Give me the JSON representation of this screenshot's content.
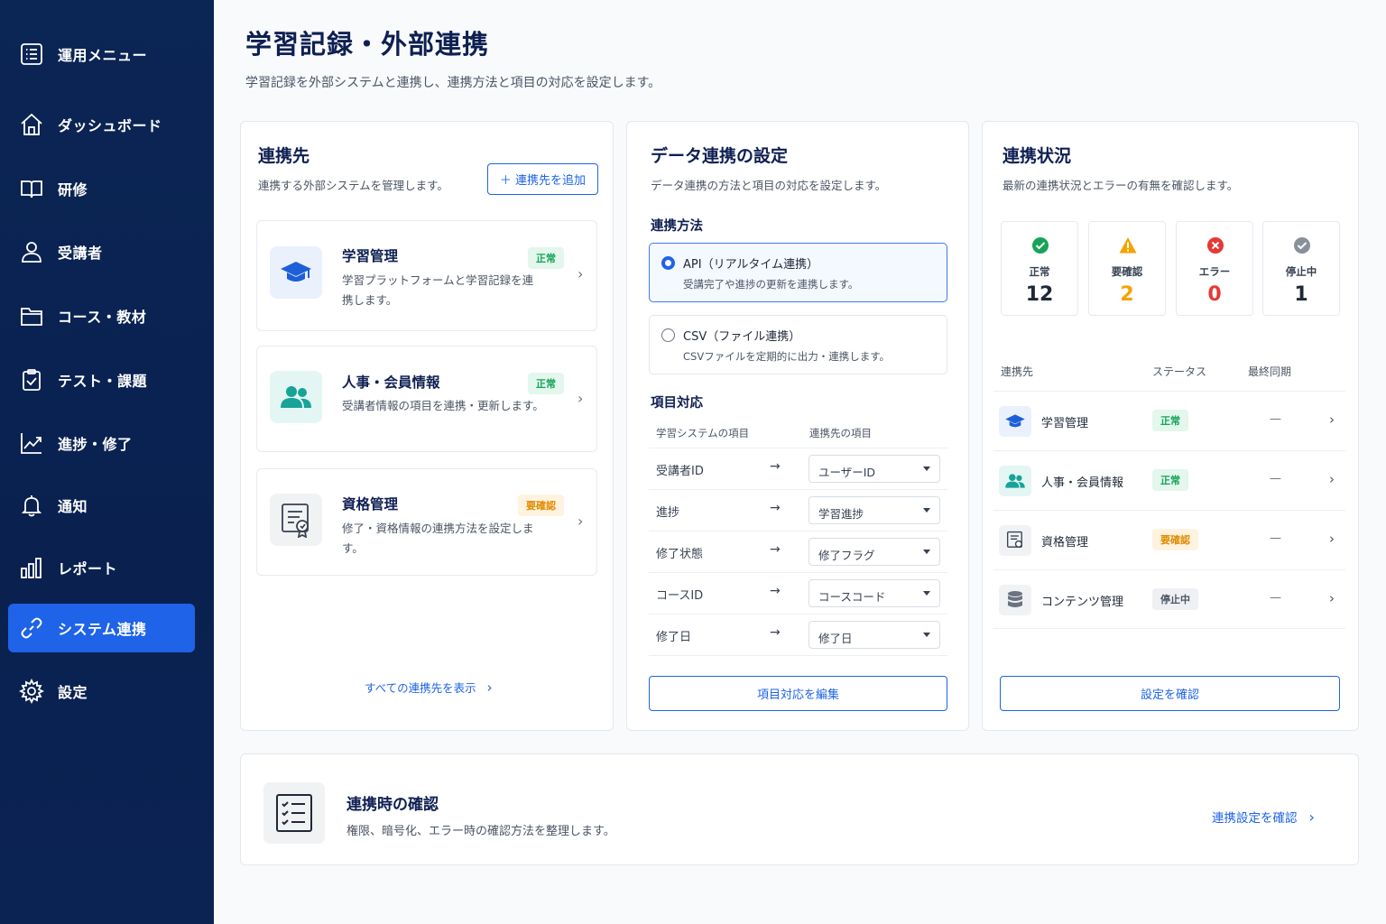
{
  "sidebar": {
    "items": [
      {
        "label": "運用メニュー",
        "icon": "menu-list-icon"
      },
      {
        "label": "ダッシュボード",
        "icon": "home-icon"
      },
      {
        "label": "研修",
        "icon": "book-icon"
      },
      {
        "label": "受講者",
        "icon": "user-icon"
      },
      {
        "label": "コース・教材",
        "icon": "folder-icon"
      },
      {
        "label": "テスト・課題",
        "icon": "clipboard-check-icon"
      },
      {
        "label": "進捗・修了",
        "icon": "line-chart-icon"
      },
      {
        "label": "通知",
        "icon": "bell-icon"
      },
      {
        "label": "レポート",
        "icon": "bar-chart-icon"
      },
      {
        "label": "システム連携",
        "icon": "link-icon",
        "active": true
      },
      {
        "label": "設定",
        "icon": "gear-icon"
      }
    ]
  },
  "page": {
    "title": "学習記録・外部連携",
    "subtitle": "学習記録を外部システムと連携し、連携方法と項目の対応を設定します。"
  },
  "destinations": {
    "title": "連携先",
    "desc": "連携する外部システムを管理します。",
    "add_button": "＋ 連携先を追加",
    "items": [
      {
        "name": "学習管理",
        "desc": "学習プラットフォームと学習記録を連携します。",
        "status": "正常",
        "icon": "graduation-cap-icon"
      },
      {
        "name": "人事・会員情報",
        "desc": "受講者情報の項目を連携・更新します。",
        "status": "正常",
        "icon": "users-icon"
      },
      {
        "name": "資格管理",
        "desc": "修了・資格情報の連携方法を設定します。",
        "status": "要確認",
        "icon": "certificate-icon"
      }
    ],
    "view_all": "すべての連携先を表示"
  },
  "data_settings": {
    "title": "データ連携の設定",
    "desc": "データ連携の方法と項目の対応を設定します。",
    "method_label": "連携方法",
    "methods": [
      {
        "title": "API（リアルタイム連携）",
        "desc": "受講完了や進捗の更新を連携します。",
        "selected": true
      },
      {
        "title": "CSV（ファイル連携）",
        "desc": "CSVファイルを定期的に出力・連携します。",
        "selected": false
      }
    ],
    "mapping_label": "項目対応",
    "mapping_headers": [
      "学習システムの項目",
      "連携先の項目"
    ],
    "mappings": [
      {
        "source": "受講者ID",
        "target": "ユーザーID"
      },
      {
        "source": "進捗",
        "target": "学習進捗"
      },
      {
        "source": "修了状態",
        "target": "修了フラグ"
      },
      {
        "source": "コースID",
        "target": "コースコード"
      },
      {
        "source": "修了日",
        "target": "修了日"
      }
    ],
    "arrow": "→",
    "edit_button": "項目対応を編集"
  },
  "status_panel": {
    "title": "連携状況",
    "desc": "最新の連携状況とエラーの有無を確認します。",
    "stats": [
      {
        "label": "正常",
        "value": "12",
        "color": "#17a35a",
        "icon": "check-circle-icon"
      },
      {
        "label": "要確認",
        "value": "2",
        "color": "#f5a300",
        "icon": "warning-icon"
      },
      {
        "label": "エラー",
        "value": "0",
        "color": "#e53935",
        "icon": "error-circle-icon"
      },
      {
        "label": "停止中",
        "value": "1",
        "color": "#1f2937",
        "icon": "paused-check-icon"
      }
    ],
    "headers": [
      "連携先",
      "ステータス",
      "最終同期"
    ],
    "rows": [
      {
        "name": "学習管理",
        "status": "正常",
        "last": "—",
        "icon": "graduation-cap-icon"
      },
      {
        "name": "人事・会員情報",
        "status": "正常",
        "last": "—",
        "icon": "users-icon"
      },
      {
        "name": "資格管理",
        "status": "要確認",
        "last": "—",
        "icon": "certificate-icon"
      },
      {
        "name": "コンテンツ管理",
        "status": "停止中",
        "last": "—",
        "icon": "database-icon"
      }
    ],
    "confirm_button": "設定を確認"
  },
  "footer_card": {
    "title": "連携時の確認",
    "desc": "権限、暗号化、エラー時の確認方法を整理します。",
    "link": "連携設定を確認",
    "icon": "checklist-icon"
  },
  "colors": {
    "sidebar_bg": "#0b2554",
    "accent": "#1e63e8",
    "ok": "#17a35a",
    "warn": "#f5a300",
    "error": "#e53935"
  }
}
